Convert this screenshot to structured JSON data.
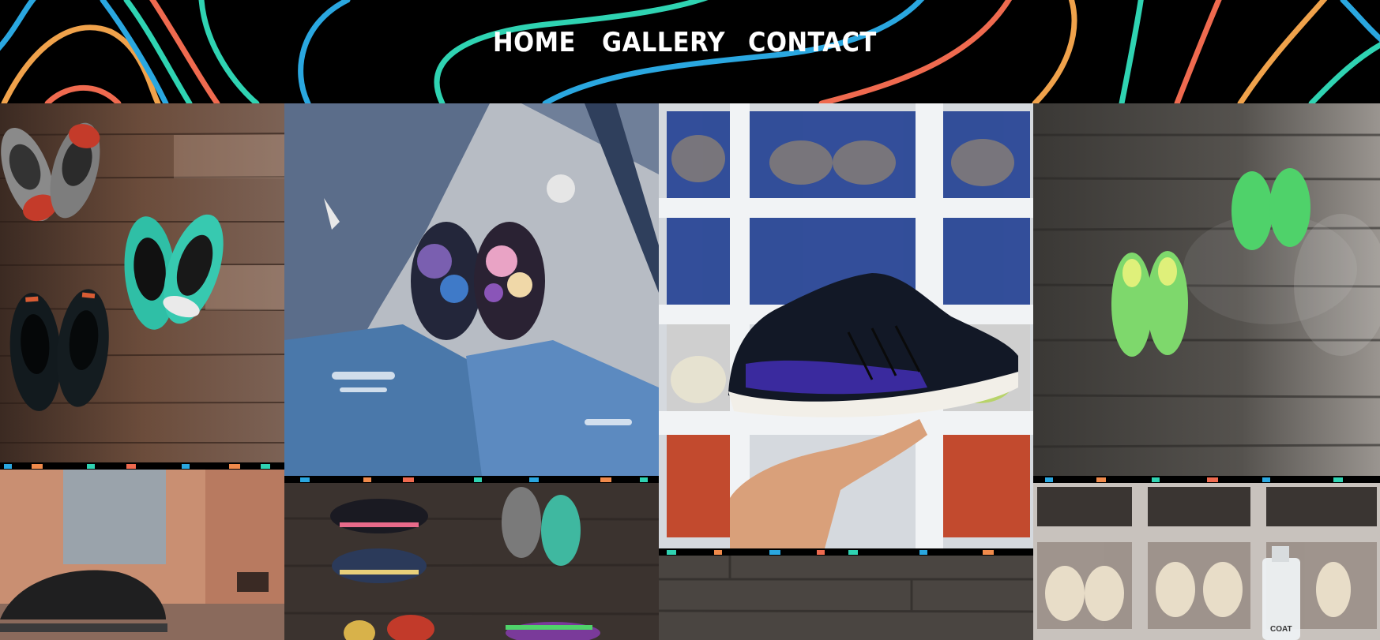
{
  "nav": {
    "home": "HOME",
    "gallery": "GALLERY",
    "contact": "CONTACT"
  },
  "colors": {
    "background": "#000000",
    "nav_text": "#ffffff",
    "wave_orange": "#f08a4b",
    "wave_teal": "#2fd3b2",
    "wave_blue": "#2aa7e0",
    "wave_coral": "#ef6a4f"
  },
  "gallery": {
    "items": [
      {
        "name": "dunks-on-wood-floor"
      },
      {
        "name": "floral-sneakers-denim"
      },
      {
        "name": "boost-runner-in-hand"
      },
      {
        "name": "green-yeezys-on-wood"
      },
      {
        "name": "black-yeezy-on-feet"
      },
      {
        "name": "sneaker-collection-flatlay"
      },
      {
        "name": "wood-floor-texture"
      },
      {
        "name": "shoe-box-wall"
      }
    ],
    "bottle_label": "COAT"
  }
}
